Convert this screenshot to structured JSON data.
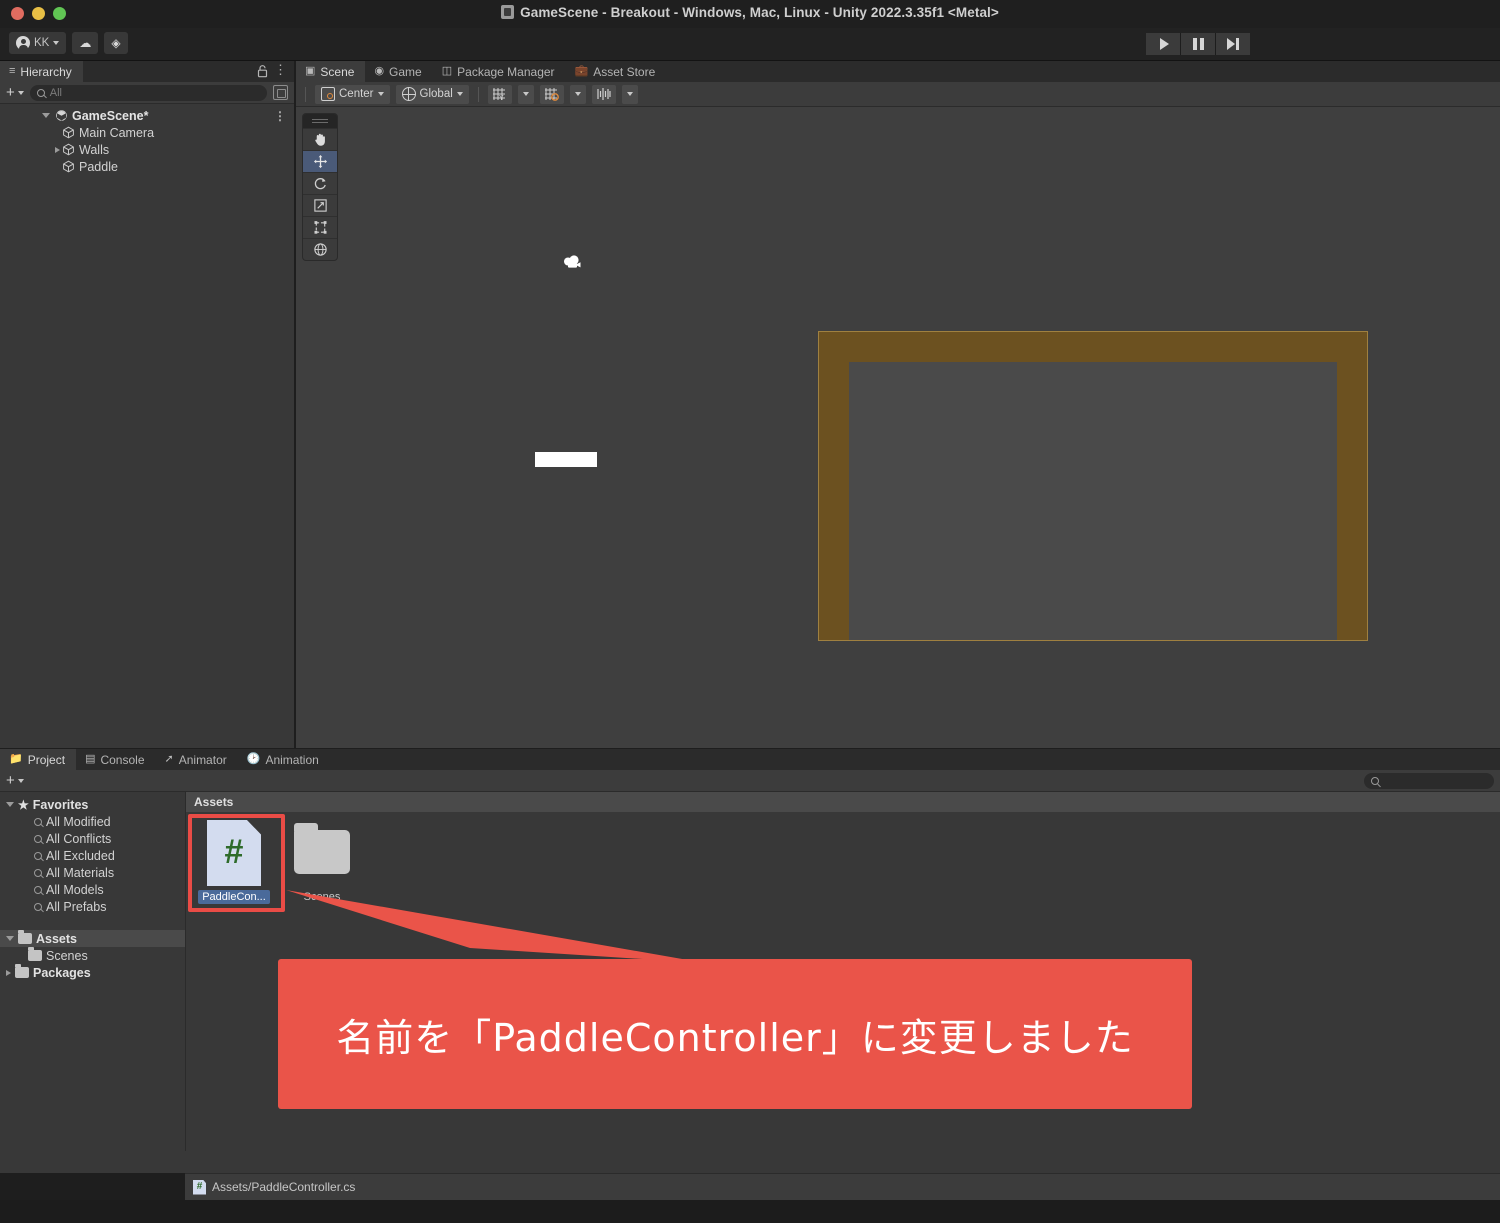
{
  "window": {
    "title": "GameScene - Breakout - Windows, Mac, Linux - Unity 2022.3.35f1 <Metal>",
    "traffic_lights": [
      "close",
      "minimize",
      "zoom"
    ]
  },
  "main_toolbar": {
    "account_label": "KK",
    "account_icon": "user-avatar-icon",
    "cloud_icon": "cloud-icon",
    "services_icon": "unity-services-icon",
    "play_label": "play-button",
    "pause_label": "pause-button",
    "step_label": "step-button"
  },
  "hierarchy": {
    "tab_label": "Hierarchy",
    "tab_icon": "hierarchy-icon",
    "lock_icon": "lock-icon",
    "menu_icon": "kebab-menu-icon",
    "add_label": "+",
    "search_placeholder": "All",
    "search_value": "",
    "items": [
      {
        "label": "GameScene*",
        "depth": 0,
        "expanded": true,
        "icon": "scene-icon",
        "has_menu": true
      },
      {
        "label": "Main Camera",
        "depth": 1,
        "expanded": null,
        "icon": "gameobject-icon",
        "has_menu": false
      },
      {
        "label": "Walls",
        "depth": 1,
        "expanded": false,
        "icon": "gameobject-icon",
        "has_menu": false
      },
      {
        "label": "Paddle",
        "depth": 1,
        "expanded": null,
        "icon": "gameobject-icon",
        "has_menu": false
      }
    ]
  },
  "scene_panel": {
    "tabs": [
      {
        "label": "Scene",
        "icon": "grid-icon",
        "active": true
      },
      {
        "label": "Game",
        "icon": "gamepad-icon",
        "active": false
      },
      {
        "label": "Package Manager",
        "icon": "package-icon",
        "active": false
      },
      {
        "label": "Asset Store",
        "icon": "store-icon",
        "active": false
      }
    ],
    "toolbar": {
      "pivot_label": "Center",
      "pivot_icon": "pivot-center-icon",
      "space_label": "Global",
      "space_icon": "globe-icon",
      "grid_snap_icon": "grid-snap-icon",
      "snap_increment_icon": "snap-increment-icon",
      "layer_vis_icon": "component-tools-icon"
    },
    "tool_palette": [
      {
        "name": "hand-tool",
        "selected": false
      },
      {
        "name": "move-tool",
        "selected": true
      },
      {
        "name": "rotate-tool",
        "selected": false
      },
      {
        "name": "scale-tool",
        "selected": false
      },
      {
        "name": "rect-tool",
        "selected": false
      },
      {
        "name": "transform-tool",
        "selected": false
      }
    ],
    "scene_objects": {
      "walls_color": "#6c5120",
      "walls_border_color": "#9f8040",
      "playfield_color": "#4a4a4a",
      "paddle_color": "#ffffff",
      "camera_gizmo": "camera-gizmo-icon"
    }
  },
  "project_panel": {
    "tabs": [
      {
        "label": "Project",
        "icon": "folder-icon",
        "active": true
      },
      {
        "label": "Console",
        "icon": "console-icon",
        "active": false
      },
      {
        "label": "Animator",
        "icon": "animator-icon",
        "active": false
      },
      {
        "label": "Animation",
        "icon": "animation-icon",
        "active": false
      }
    ],
    "add_label": "+",
    "search_placeholder": "",
    "search_value": "",
    "tree": [
      {
        "label": "Favorites",
        "depth": 0,
        "expanded": true,
        "icon": "star-icon",
        "bold": true,
        "selected": false
      },
      {
        "label": "All Modified",
        "depth": 1,
        "icon": "search-icon",
        "bold": false,
        "selected": false
      },
      {
        "label": "All Conflicts",
        "depth": 1,
        "icon": "search-icon",
        "bold": false,
        "selected": false
      },
      {
        "label": "All Excluded",
        "depth": 1,
        "icon": "search-icon",
        "bold": false,
        "selected": false
      },
      {
        "label": "All Materials",
        "depth": 1,
        "icon": "search-icon",
        "bold": false,
        "selected": false
      },
      {
        "label": "All Models",
        "depth": 1,
        "icon": "search-icon",
        "bold": false,
        "selected": false
      },
      {
        "label": "All Prefabs",
        "depth": 1,
        "icon": "search-icon",
        "bold": false,
        "selected": false
      },
      {
        "label": "Assets",
        "depth": 0,
        "expanded": true,
        "icon": "folder-open-icon",
        "bold": true,
        "selected": true
      },
      {
        "label": "Scenes",
        "depth": 1,
        "icon": "folder-icon",
        "bold": false,
        "selected": false
      },
      {
        "label": "Packages",
        "depth": 0,
        "expanded": false,
        "icon": "folder-icon",
        "bold": true,
        "selected": false
      }
    ],
    "breadcrumb": "Assets",
    "assets": [
      {
        "label": "PaddleCon...",
        "icon": "csharp-script-icon",
        "selected": true,
        "highlighted": true
      },
      {
        "label": "Scenes",
        "icon": "folder-icon",
        "selected": false,
        "highlighted": false
      }
    ]
  },
  "status_bar": {
    "path": "Assets/PaddleController.cs",
    "icon": "csharp-script-icon"
  },
  "annotation": {
    "text": "名前を「PaddleController」に変更しました",
    "color": "#ea5449",
    "highlight_border_color": "#ea4c46"
  }
}
